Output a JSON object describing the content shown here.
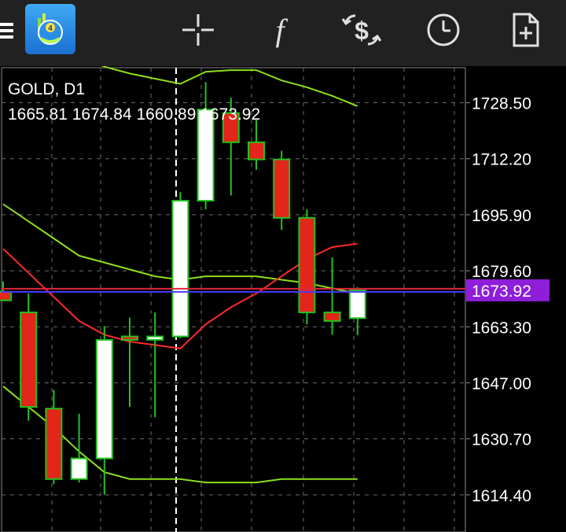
{
  "toolbar": {
    "menu_icon": "hamburger-menu-icon",
    "app_icon": "metatrader-logo-icon",
    "crosshair_icon": "crosshair-icon",
    "indicators_icon": "function-f-icon",
    "trade_icon": "dollar-cycle-icon",
    "timeframe_icon": "clock-icon",
    "new_order_icon": "add-document-icon"
  },
  "chart_header": {
    "symbol_timeframe": "GOLD, D1",
    "ohlc": "1665.81 1674.84 1660.89 1673.92"
  },
  "colors": {
    "bull_candle": "#ffffff",
    "bear_candle": "#e3261a",
    "candle_outline": "#21c11e",
    "band": "#8de01a",
    "moving_average": "#ff2a2a",
    "bid_line": "#e0263c",
    "ask_line": "#4a3aff",
    "price_tag_bg": "#8f1ed8",
    "background": "#000000"
  },
  "chart_data": {
    "type": "candlestick",
    "yaxis_ticks": [
      "1728.50",
      "1712.20",
      "1695.90",
      "1679.60",
      "1663.30",
      "1647.00",
      "1630.70",
      "1614.40"
    ],
    "ylim": [
      1603.6,
      1738.7
    ],
    "current_price": "1673.92",
    "candles": [
      {
        "o": 1673.5,
        "h": 1676.5,
        "l": 1672.5,
        "c": 1671.0
      },
      {
        "o": 1667.5,
        "h": 1673.0,
        "l": 1636.0,
        "c": 1640.0
      },
      {
        "o": 1639.5,
        "h": 1645.0,
        "l": 1617.5,
        "c": 1619.0
      },
      {
        "o": 1619.0,
        "h": 1638.0,
        "l": 1618.0,
        "c": 1625.0
      },
      {
        "o": 1625.0,
        "h": 1663.5,
        "l": 1614.5,
        "c": 1659.5
      },
      {
        "o": 1660.5,
        "h": 1666.0,
        "l": 1640.0,
        "c": 1659.5
      },
      {
        "o": 1659.5,
        "h": 1667.5,
        "l": 1637.0,
        "c": 1660.5
      },
      {
        "o": 1660.5,
        "h": 1702.5,
        "l": 1660.0,
        "c": 1700.0
      },
      {
        "o": 1700.0,
        "h": 1734.5,
        "l": 1697.5,
        "c": 1726.5
      },
      {
        "o": 1725.5,
        "h": 1730.0,
        "l": 1701.5,
        "c": 1717.0
      },
      {
        "o": 1717.0,
        "h": 1723.5,
        "l": 1709.0,
        "c": 1712.0
      },
      {
        "o": 1712.0,
        "h": 1714.5,
        "l": 1691.5,
        "c": 1695.0
      },
      {
        "o": 1695.0,
        "h": 1697.5,
        "l": 1664.0,
        "c": 1667.5
      },
      {
        "o": 1667.5,
        "h": 1683.5,
        "l": 1661.0,
        "c": 1665.0
      },
      {
        "o": 1665.81,
        "h": 1674.84,
        "l": 1660.89,
        "c": 1673.92
      }
    ],
    "upper_band": [
      1749.0,
      1746.0,
      1744.0,
      1742.0,
      1739.0,
      1737.0,
      1735.5,
      1734.0,
      1737.5,
      1738.0,
      1738.0,
      1735.0,
      1733.0,
      1730.5,
      1727.5
    ],
    "middle_band": [
      1699.0,
      1694.0,
      1689.0,
      1684.0,
      1682.0,
      1680.0,
      1678.0,
      1677.0,
      1678.0,
      1678.0,
      1678.0,
      1677.0,
      1676.0,
      1674.5,
      1673.0
    ],
    "lower_band": [
      1646.0,
      1640.0,
      1634.0,
      1627.0,
      1621.0,
      1619.0,
      1619.0,
      1619.0,
      1618.0,
      1618.0,
      1618.0,
      1619.0,
      1619.0,
      1619.0,
      1619.0
    ],
    "moving_average": [
      1686.0,
      1679.0,
      1672.0,
      1665.0,
      1661.0,
      1659.0,
      1658.0,
      1657.0,
      1664.0,
      1669.0,
      1673.0,
      1678.0,
      1683.0,
      1686.5,
      1687.5
    ]
  }
}
